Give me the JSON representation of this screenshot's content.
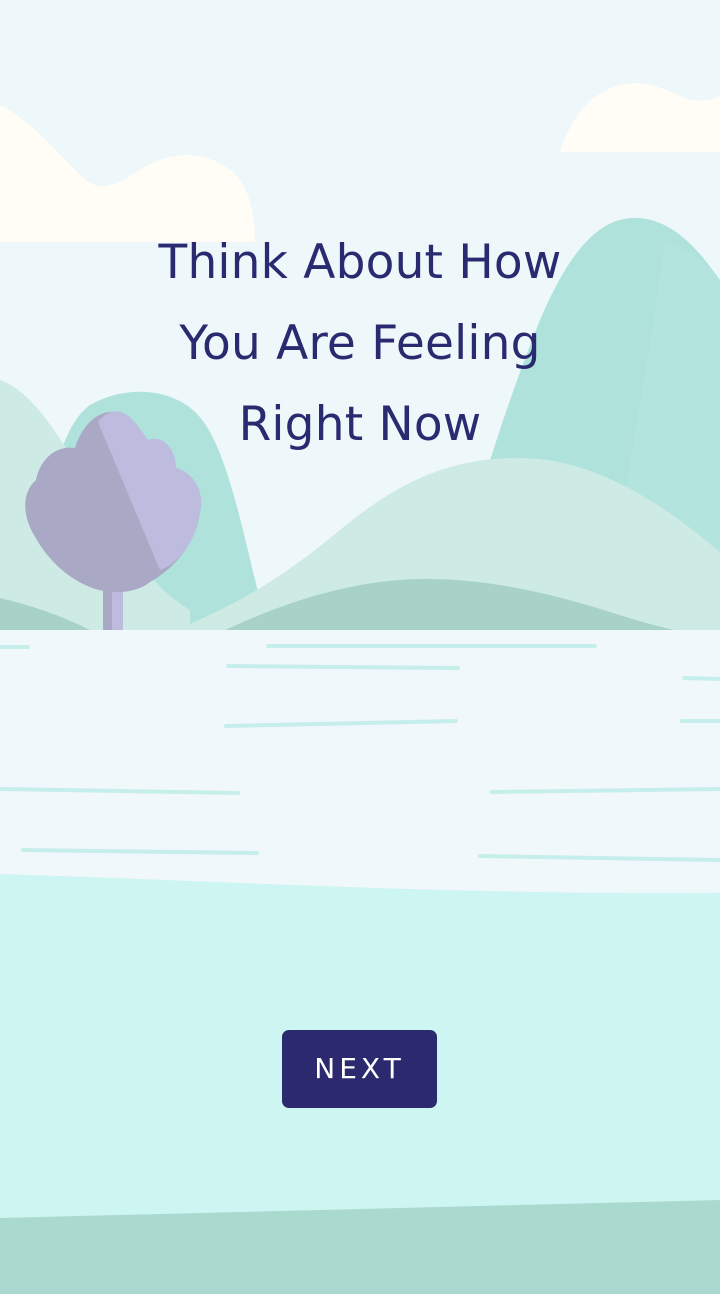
{
  "onboarding": {
    "headline_lines": [
      "Think About How",
      "You Are Feeling",
      "Right Now"
    ],
    "next_label": "NEXT"
  },
  "colors": {
    "sky": "#eef7fa",
    "cloud": "#fffdf6",
    "hill_teal": "#b0e2dc",
    "hill_light": "#ceeae4",
    "hill_mid": "#a8d2c6",
    "tree_purple": "#a9a9c6",
    "tree_highlight": "#bdbcde",
    "water": "#f1f8fb",
    "water_lines": "#c6eeea",
    "shore": "#cdf5f1",
    "ground_bottom": "#aad9cf",
    "text_primary": "#2a2a70",
    "button_bg": "#2b2a6e",
    "button_text": "#ffffff"
  }
}
